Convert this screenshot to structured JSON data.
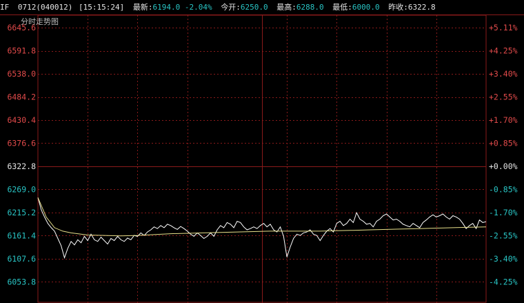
{
  "header": {
    "symbol": "IF",
    "contract": "0712(040012)",
    "time": "[15:15:24]",
    "latest_label": "最新:",
    "latest_value": "6194.0",
    "change": "-2.04%",
    "open_label": "今开:",
    "open_value": "6250.0",
    "high_label": "最高:",
    "high_value": "6288.0",
    "low_label": "最低:",
    "low_value": "6000.0",
    "prev_close_label": "昨收:",
    "prev_close_value": "6322.8"
  },
  "colors": {
    "background": "#000000",
    "grid": "#8b1a1a",
    "price_line": "#ffffff",
    "avg_line": "#e8e08a",
    "up": "#e14a4a",
    "down": "#29c4c4",
    "flat": "#e6e6e6"
  },
  "chart_data": {
    "type": "line",
    "title": "分时走势图",
    "prev_close": 6322.8,
    "ylim": [
      6000,
      6700
    ],
    "y_ticks": [
      "6645.6",
      "6591.8",
      "6538.0",
      "6484.2",
      "6430.4",
      "6376.6",
      "6322.8",
      "6269.0",
      "6215.2",
      "6161.4",
      "6107.6",
      "6053.8"
    ],
    "pct_ticks": [
      "+5.11%",
      "+4.25%",
      "+3.40%",
      "+2.55%",
      "+1.70%",
      "+0.85%",
      "+0.00%",
      "-0.85%",
      "-1.70%",
      "-2.55%",
      "-3.40%",
      "-4.25%"
    ],
    "x_minutes": 270,
    "series": [
      {
        "key": "price",
        "points": [
          [
            0,
            6250
          ],
          [
            2,
            6222
          ],
          [
            4,
            6205
          ],
          [
            6,
            6190
          ],
          [
            8,
            6180
          ],
          [
            10,
            6172
          ],
          [
            12,
            6155
          ],
          [
            14,
            6138
          ],
          [
            16,
            6110
          ],
          [
            18,
            6132
          ],
          [
            20,
            6148
          ],
          [
            22,
            6140
          ],
          [
            24,
            6152
          ],
          [
            26,
            6145
          ],
          [
            28,
            6160
          ],
          [
            30,
            6150
          ],
          [
            32,
            6165
          ],
          [
            34,
            6152
          ],
          [
            36,
            6148
          ],
          [
            38,
            6158
          ],
          [
            40,
            6150
          ],
          [
            42,
            6142
          ],
          [
            44,
            6155
          ],
          [
            46,
            6150
          ],
          [
            48,
            6160
          ],
          [
            50,
            6152
          ],
          [
            52,
            6148
          ],
          [
            54,
            6156
          ],
          [
            56,
            6152
          ],
          [
            58,
            6162
          ],
          [
            60,
            6160
          ],
          [
            62,
            6168
          ],
          [
            64,
            6162
          ],
          [
            66,
            6170
          ],
          [
            68,
            6175
          ],
          [
            70,
            6182
          ],
          [
            72,
            6178
          ],
          [
            74,
            6185
          ],
          [
            76,
            6180
          ],
          [
            78,
            6188
          ],
          [
            80,
            6185
          ],
          [
            82,
            6180
          ],
          [
            84,
            6176
          ],
          [
            86,
            6183
          ],
          [
            88,
            6178
          ],
          [
            90,
            6172
          ],
          [
            92,
            6165
          ],
          [
            94,
            6160
          ],
          [
            96,
            6168
          ],
          [
            98,
            6162
          ],
          [
            100,
            6155
          ],
          [
            102,
            6160
          ],
          [
            104,
            6168
          ],
          [
            106,
            6160
          ],
          [
            108,
            6175
          ],
          [
            110,
            6185
          ],
          [
            112,
            6180
          ],
          [
            114,
            6192
          ],
          [
            116,
            6188
          ],
          [
            118,
            6180
          ],
          [
            120,
            6195
          ],
          [
            122,
            6192
          ],
          [
            124,
            6182
          ],
          [
            126,
            6175
          ],
          [
            128,
            6178
          ],
          [
            130,
            6182
          ],
          [
            132,
            6178
          ],
          [
            134,
            6185
          ],
          [
            136,
            6190
          ],
          [
            138,
            6182
          ],
          [
            140,
            6188
          ],
          [
            142,
            6175
          ],
          [
            144,
            6170
          ],
          [
            146,
            6182
          ],
          [
            148,
            6160
          ],
          [
            150,
            6112
          ],
          [
            152,
            6135
          ],
          [
            154,
            6155
          ],
          [
            156,
            6165
          ],
          [
            158,
            6162
          ],
          [
            160,
            6168
          ],
          [
            162,
            6170
          ],
          [
            164,
            6175
          ],
          [
            166,
            6165
          ],
          [
            168,
            6162
          ],
          [
            170,
            6150
          ],
          [
            172,
            6162
          ],
          [
            174,
            6172
          ],
          [
            176,
            6178
          ],
          [
            178,
            6170
          ],
          [
            180,
            6190
          ],
          [
            182,
            6195
          ],
          [
            184,
            6185
          ],
          [
            186,
            6190
          ],
          [
            188,
            6200
          ],
          [
            190,
            6192
          ],
          [
            192,
            6215
          ],
          [
            194,
            6200
          ],
          [
            196,
            6195
          ],
          [
            198,
            6188
          ],
          [
            200,
            6190
          ],
          [
            202,
            6182
          ],
          [
            204,
            6195
          ],
          [
            206,
            6200
          ],
          [
            208,
            6208
          ],
          [
            210,
            6212
          ],
          [
            212,
            6205
          ],
          [
            214,
            6198
          ],
          [
            216,
            6200
          ],
          [
            218,
            6195
          ],
          [
            220,
            6188
          ],
          [
            222,
            6185
          ],
          [
            224,
            6182
          ],
          [
            226,
            6190
          ],
          [
            228,
            6185
          ],
          [
            230,
            6180
          ],
          [
            232,
            6192
          ],
          [
            234,
            6198
          ],
          [
            236,
            6205
          ],
          [
            238,
            6210
          ],
          [
            240,
            6205
          ],
          [
            242,
            6208
          ],
          [
            244,
            6212
          ],
          [
            246,
            6205
          ],
          [
            248,
            6200
          ],
          [
            250,
            6208
          ],
          [
            252,
            6205
          ],
          [
            254,
            6200
          ],
          [
            256,
            6190
          ],
          [
            258,
            6178
          ],
          [
            260,
            6185
          ],
          [
            262,
            6190
          ],
          [
            264,
            6178
          ],
          [
            266,
            6198
          ],
          [
            268,
            6192
          ],
          [
            270,
            6194
          ]
        ]
      },
      {
        "key": "average",
        "points": [
          [
            0,
            6250
          ],
          [
            5,
            6205
          ],
          [
            10,
            6180
          ],
          [
            15,
            6172
          ],
          [
            20,
            6168
          ],
          [
            30,
            6163
          ],
          [
            40,
            6162
          ],
          [
            50,
            6161
          ],
          [
            60,
            6162
          ],
          [
            70,
            6164
          ],
          [
            80,
            6166
          ],
          [
            90,
            6167
          ],
          [
            100,
            6168
          ],
          [
            110,
            6169
          ],
          [
            120,
            6170
          ],
          [
            130,
            6171
          ],
          [
            140,
            6172
          ],
          [
            150,
            6172
          ],
          [
            160,
            6172
          ],
          [
            170,
            6172
          ],
          [
            180,
            6173
          ],
          [
            190,
            6174
          ],
          [
            200,
            6175
          ],
          [
            210,
            6176
          ],
          [
            220,
            6177
          ],
          [
            230,
            6178
          ],
          [
            240,
            6179
          ],
          [
            250,
            6180
          ],
          [
            260,
            6181
          ],
          [
            270,
            6182
          ]
        ]
      }
    ]
  }
}
